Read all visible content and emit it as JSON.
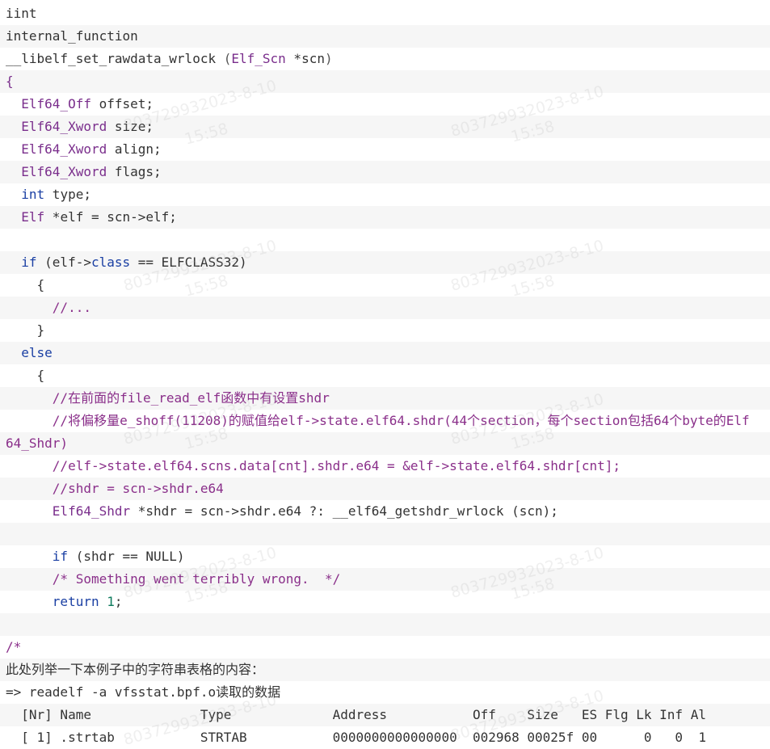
{
  "code": {
    "lines": [
      [
        {
          "t": "iint",
          "c": ""
        }
      ],
      [
        {
          "t": "internal_function",
          "c": ""
        }
      ],
      [
        {
          "t": "__libelf_set_rawdata_wrlock ",
          "c": ""
        },
        {
          "t": "(",
          "c": "punc"
        },
        {
          "t": "Elf_Scn",
          "c": "type"
        },
        {
          "t": " *scn",
          "c": ""
        },
        {
          "t": ")",
          "c": "punc"
        }
      ],
      [
        {
          "t": "{",
          "c": "type"
        }
      ],
      [
        {
          "t": "  ",
          "c": ""
        },
        {
          "t": "Elf64_Off",
          "c": "type"
        },
        {
          "t": " offset;",
          "c": ""
        }
      ],
      [
        {
          "t": "  ",
          "c": ""
        },
        {
          "t": "Elf64_Xword",
          "c": "type"
        },
        {
          "t": " size;",
          "c": ""
        }
      ],
      [
        {
          "t": "  ",
          "c": ""
        },
        {
          "t": "Elf64_Xword",
          "c": "type"
        },
        {
          "t": " align;",
          "c": ""
        }
      ],
      [
        {
          "t": "  ",
          "c": ""
        },
        {
          "t": "Elf64_Xword",
          "c": "type"
        },
        {
          "t": " flags;",
          "c": ""
        }
      ],
      [
        {
          "t": "  ",
          "c": ""
        },
        {
          "t": "int",
          "c": "kw"
        },
        {
          "t": " type;",
          "c": ""
        }
      ],
      [
        {
          "t": "  ",
          "c": ""
        },
        {
          "t": "Elf",
          "c": "type"
        },
        {
          "t": " *elf = scn->elf;",
          "c": ""
        }
      ],
      [
        {
          "t": "",
          "c": ""
        }
      ],
      [
        {
          "t": "  ",
          "c": ""
        },
        {
          "t": "if",
          "c": "kw"
        },
        {
          "t": " (elf->",
          "c": ""
        },
        {
          "t": "class",
          "c": "kw"
        },
        {
          "t": " == ELFCLASS32)",
          "c": ""
        }
      ],
      [
        {
          "t": "    {",
          "c": ""
        }
      ],
      [
        {
          "t": "      ",
          "c": ""
        },
        {
          "t": "//...",
          "c": "comment"
        }
      ],
      [
        {
          "t": "    }",
          "c": ""
        }
      ],
      [
        {
          "t": "  ",
          "c": ""
        },
        {
          "t": "else",
          "c": "kw"
        }
      ],
      [
        {
          "t": "    {",
          "c": ""
        }
      ],
      [
        {
          "t": "      ",
          "c": ""
        },
        {
          "t": "//在前面的file_read_elf函数中有设置shdr",
          "c": "comment"
        }
      ],
      [
        {
          "t": "      ",
          "c": ""
        },
        {
          "t": "//将偏移量e_shoff(11208)的赋值给elf->state.elf64.shdr(44个section，每个section包括64个byte的Elf",
          "c": "comment"
        }
      ],
      [
        {
          "t": "64_Shdr)",
          "c": "comment"
        }
      ],
      [
        {
          "t": "      ",
          "c": ""
        },
        {
          "t": "//elf->state.elf64.scns.data[cnt].shdr.e64 = &elf->state.elf64.shdr[cnt];",
          "c": "comment"
        }
      ],
      [
        {
          "t": "      ",
          "c": ""
        },
        {
          "t": "//shdr = scn->shdr.e64",
          "c": "comment"
        }
      ],
      [
        {
          "t": "      ",
          "c": ""
        },
        {
          "t": "Elf64_Shdr",
          "c": "type"
        },
        {
          "t": " *shdr = scn->shdr.e64 ?: __elf64_getshdr_wrlock (scn);",
          "c": ""
        }
      ],
      [
        {
          "t": "",
          "c": ""
        }
      ],
      [
        {
          "t": "      ",
          "c": ""
        },
        {
          "t": "if",
          "c": "kw"
        },
        {
          "t": " (shdr == NULL)",
          "c": ""
        }
      ],
      [
        {
          "t": "      ",
          "c": ""
        },
        {
          "t": "/* Something went terribly wrong.  */",
          "c": "comment"
        }
      ],
      [
        {
          "t": "      ",
          "c": ""
        },
        {
          "t": "return",
          "c": "kw"
        },
        {
          "t": " ",
          "c": ""
        },
        {
          "t": "1",
          "c": "num"
        },
        {
          "t": ";",
          "c": ""
        }
      ],
      [
        {
          "t": "",
          "c": ""
        }
      ],
      [
        {
          "t": "/*",
          "c": "comment"
        }
      ],
      [
        {
          "t": "此处列举一下本例子中的字符串表格的内容：",
          "c": "plain"
        }
      ],
      [
        {
          "t": "=> readelf -a vfsstat.bpf.o读取的数据",
          "c": "plain"
        }
      ],
      [
        {
          "t": "  [Nr] Name              Type             Address           Off    Size   ES Flg Lk Inf Al",
          "c": "plain"
        }
      ],
      [
        {
          "t": "  [ 1] .strtab           STRTAB           0000000000000000  002968 00025f 00      0   0  1",
          "c": "plain"
        }
      ]
    ]
  },
  "watermark": {
    "text_a": "803729932023-8-10",
    "text_b": "15:58"
  }
}
